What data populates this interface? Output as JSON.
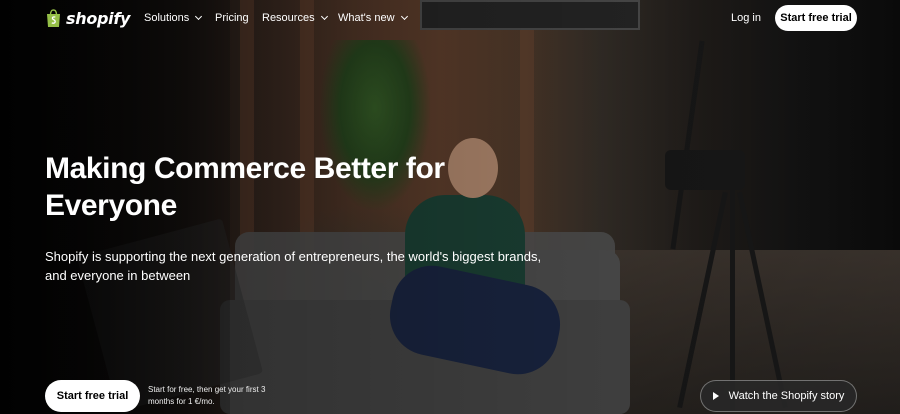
{
  "nav": {
    "brand": "shopify",
    "items": [
      {
        "label": "Solutions",
        "has_dropdown": true
      },
      {
        "label": "Pricing",
        "has_dropdown": false
      },
      {
        "label": "Resources",
        "has_dropdown": true
      },
      {
        "label": "What's new",
        "has_dropdown": true
      }
    ],
    "login_label": "Log in",
    "trial_label": "Start free trial"
  },
  "hero": {
    "headline": "Making Commerce Better for Everyone",
    "subheadline": "Shopify is supporting the next generation of entrepreneurs, the world's biggest brands, and everyone in between",
    "cta_label": "Start free trial",
    "offer_text": "Start for free, then get your first 3 months for 1 €/mo.",
    "watch_label": "Watch the Shopify story"
  },
  "icons": {
    "logo": "shopping-bag-icon",
    "dropdown": "chevron-down-icon",
    "play": "play-icon"
  },
  "colors": {
    "logo_green": "#95bf47",
    "button_bg": "#ffffff",
    "button_text": "#000000"
  }
}
